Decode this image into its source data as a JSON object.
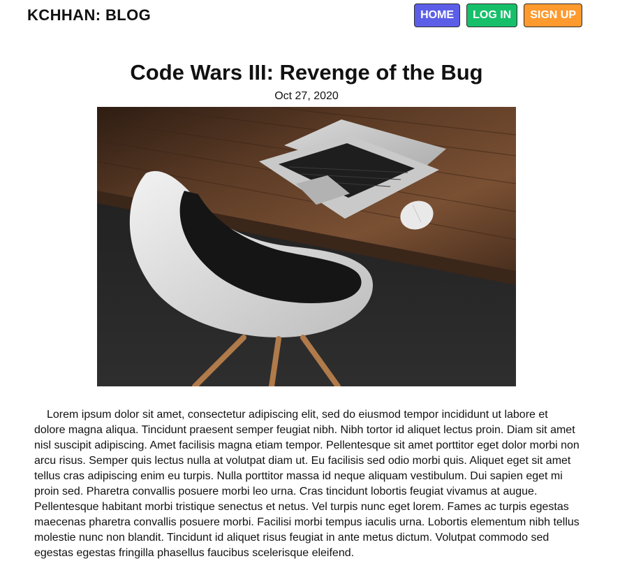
{
  "site": {
    "brand": "KCHHAN: BLOG"
  },
  "nav": {
    "home": "HOME",
    "login": "LOG IN",
    "signup": "SIGN UP",
    "colors": {
      "home": "#5c5ee8",
      "login": "#16c06a",
      "signup": "#ff9a2e"
    }
  },
  "post": {
    "title": "Code Wars III: Revenge of the Bug",
    "date": "Oct 27, 2020",
    "image_subject": "white-chair-and-laptop-on-wooden-desk",
    "body": "Lorem ipsum dolor sit amet, consectetur adipiscing elit, sed do eiusmod tempor incididunt ut labore et dolore magna aliqua. Tincidunt praesent semper feugiat nibh. Nibh tortor id aliquet lectus proin. Diam sit amet nisl suscipit adipiscing. Amet facilisis magna etiam tempor. Pellentesque sit amet porttitor eget dolor morbi non arcu risus. Semper quis lectus nulla at volutpat diam ut. Eu facilisis sed odio morbi quis. Aliquet eget sit amet tellus cras adipiscing enim eu turpis. Nulla porttitor massa id neque aliquam vestibulum. Dui sapien eget mi proin sed. Pharetra convallis posuere morbi leo urna. Cras tincidunt lobortis feugiat vivamus at augue. Pellentesque habitant morbi tristique senectus et netus. Vel turpis nunc eget lorem. Fames ac turpis egestas maecenas pharetra convallis posuere morbi. Facilisi morbi tempus iaculis urna. Lobortis elementum nibh tellus molestie nunc non blandit. Tincidunt id aliquet risus feugiat in ante metus dictum. Volutpat commodo sed egestas egestas fringilla phasellus faucibus scelerisque eleifend."
  }
}
